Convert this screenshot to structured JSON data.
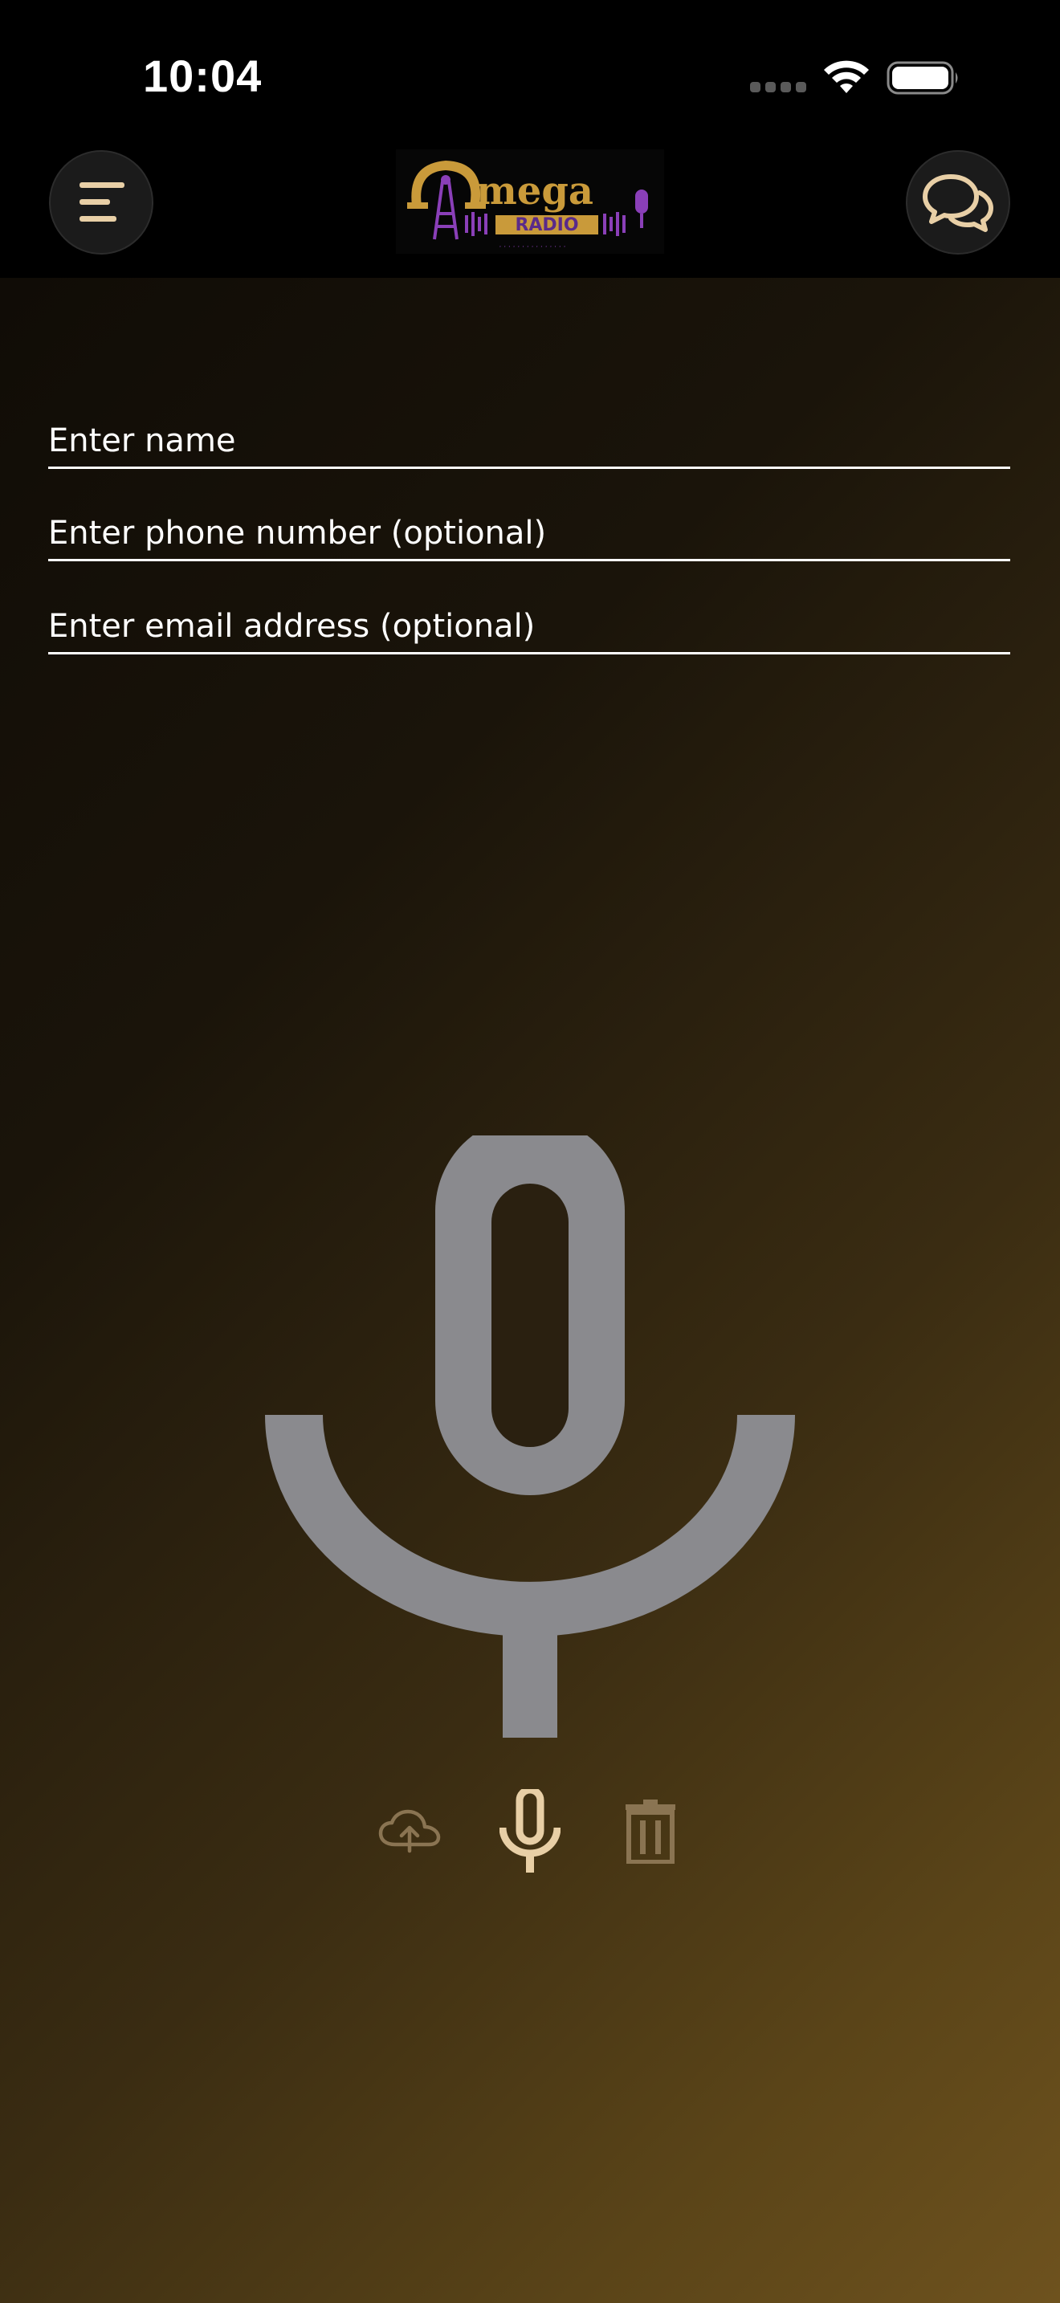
{
  "status_bar": {
    "time": "10:04"
  },
  "header": {
    "menu_icon": "hamburger-menu-icon",
    "logo_alt": "Omega Radio",
    "chat_icon": "chat-bubbles-icon"
  },
  "form": {
    "name_placeholder": "Enter name",
    "phone_placeholder": "Enter phone number (optional)",
    "email_placeholder": "Enter email address (optional)"
  },
  "recorder": {
    "big_icon": "microphone-icon",
    "controls": [
      {
        "icon": "cloud-upload-icon"
      },
      {
        "icon": "microphone-icon"
      },
      {
        "icon": "trash-icon"
      }
    ]
  },
  "colors": {
    "accent": "#e8cfa6",
    "mic_gray": "#8a8a8e",
    "header_bg": "#000000",
    "gradient_end": "#6e521e"
  }
}
